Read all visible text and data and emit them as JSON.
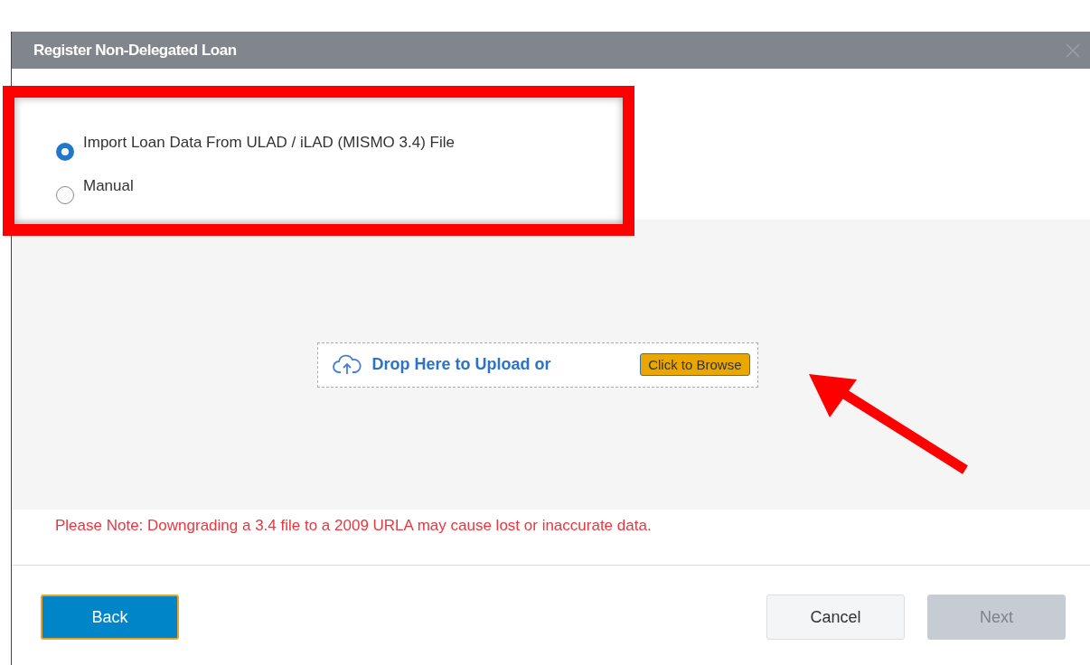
{
  "dialog": {
    "title": "Register Non-Delegated Loan"
  },
  "options": [
    {
      "label": "Import Loan Data From ULAD / iLAD (MISMO 3.4) File",
      "selected": true
    },
    {
      "label": "Manual",
      "selected": false
    }
  ],
  "upload": {
    "text": "Drop Here to Upload or",
    "button": "Click to Browse"
  },
  "note": "Please Note: Downgrading a 3.4 file to a 2009 URLA may cause lost or inaccurate data.",
  "buttons": [
    {
      "label": "Back",
      "kind": "primary",
      "disabled": false
    },
    {
      "label": "Cancel",
      "kind": "secondary",
      "disabled": false
    },
    {
      "label": "Next",
      "kind": "primary",
      "disabled": true
    }
  ]
}
